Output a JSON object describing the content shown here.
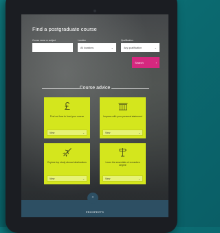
{
  "page": {
    "title": "Find a postgraduate course"
  },
  "search": {
    "course_label": "Course name or subject",
    "course_value": "",
    "location_label": "Location",
    "location_value": "All locations",
    "qualification_label": "Qualification",
    "qualification_value": "Any qualification",
    "search_label": "Search"
  },
  "advice": {
    "title": "Course advice",
    "cards": [
      {
        "text": "Find out how to fund your course",
        "view": "View",
        "icon": "pound-icon"
      },
      {
        "text": "Impress with your personal statement",
        "view": "View",
        "icon": "pillars-icon"
      },
      {
        "text": "Explore top study abroad destinations",
        "view": "View",
        "icon": "plane-icon"
      },
      {
        "text": "Learn the essentials of a masters degree",
        "view": "View",
        "icon": "signpost-icon"
      }
    ]
  },
  "footer": {
    "brand": "PROSPECTS"
  },
  "colors": {
    "card_accent": "#d4e61d",
    "search_button": "#d6287f",
    "footer_bar": "#2d4f63",
    "background": "#0f7d82"
  }
}
